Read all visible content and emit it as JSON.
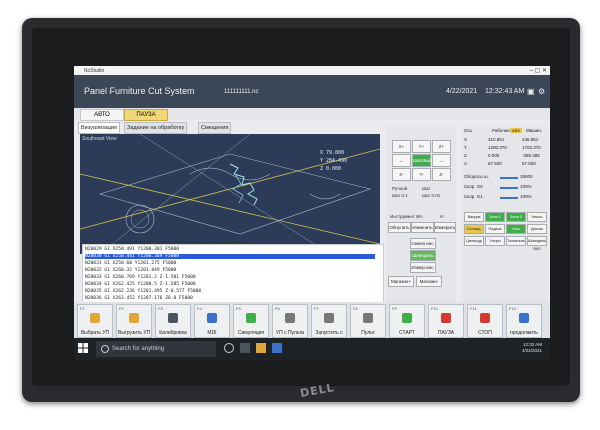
{
  "titlebar": {
    "app": "NcStudio"
  },
  "header": {
    "title": "Panel Furniture Cut System",
    "file": "111111111.nc",
    "date": "4/22/2021",
    "time": "12:32:43 AM"
  },
  "modes": [
    {
      "label": "АВТО"
    },
    {
      "label": "ПАУЗА"
    }
  ],
  "tabs": [
    {
      "label": "Визуализация"
    },
    {
      "label": "Задание на обработку"
    },
    {
      "label": "Смещения"
    }
  ],
  "viewport": {
    "view_label": "Southeast View",
    "coords": [
      "X  79.800",
      "Y  284.490",
      "Z  0.000"
    ]
  },
  "status_message": "Memory: 10MCSSM    The track occupies too much memory and it has been automatically cut.",
  "nc_lines": [
    {
      "text": "N20029  G1 X250.491 Y1200.381 F5000",
      "selected": false
    },
    {
      "text": "N20030  G1 X250.441 Y1200.369 F5000",
      "selected": true
    },
    {
      "text": "N20031  G1 X250.68 Y1201.275 F5000",
      "selected": false
    },
    {
      "text": "N20032  G1 X260.32 Y1201.849 F5000",
      "selected": false
    },
    {
      "text": "N20033  G1 X260.769 Y1201.2 Z-1.581 F5000",
      "selected": false
    },
    {
      "text": "N20034  G1 X262.425 Y1200.5 Z-1.585 F5000",
      "selected": false
    },
    {
      "text": "N20035  G1 X262.236 Y1201.495 Z-0.577 F5000",
      "selected": false
    },
    {
      "text": "N20036  G1 X263.452 Y1207.176 Z0.0 F5000",
      "selected": false
    },
    {
      "text": "N20037  G1 X263.453 Y1206.01 Z-0.511 F5000",
      "selected": false
    }
  ],
  "jog": {
    "keys": [
      "X+",
      "Y+",
      "Z+",
      "X-",
      "Y-",
      "Z-"
    ],
    "center": "Шаговый",
    "options": [
      "Ручной",
      "Шаг",
      "Шаг 0.1",
      "Шаг 0.01"
    ]
  },
  "tool": {
    "label": "Инструмент ИН",
    "n_label": "Н:",
    "buttons": [
      "Обнулить",
      "Изменить",
      "Измерить"
    ],
    "spindle": [
      "Смена инс.",
      "Шпиндель",
      "Измер.инс.",
      "Магазин+",
      "Магазин-"
    ]
  },
  "coords_panel": {
    "headers": [
      "Ось",
      "Рабочие",
      "Машин."
    ],
    "rows": [
      {
        "axis": "X",
        "work": "310.861",
        "mach": "446.861"
      },
      {
        "axis": "Y",
        "work": "1200.370",
        "mach": "1702.370"
      },
      {
        "axis": "Z",
        "work": "0.000",
        "mach": "-385.385"
      },
      {
        "axis": "A",
        "work": "67.500",
        "mach": "67.500"
      }
    ],
    "badge": "ABS",
    "feed_labels": [
      "Обороты ш.",
      "Скор. G0",
      "Скор. G1"
    ],
    "feed_values": [
      "18000",
      "100%",
      "100%"
    ],
    "buttons": [
      "Вакуум",
      "Зона 1",
      "Зона 2",
      "Насос",
      "Охлажд.",
      "Подача",
      "Нож",
      "Датчик",
      "Цилиндр",
      "Упоры",
      "Толкатель",
      "Шпиндель ВКЛ"
    ]
  },
  "fkeys": [
    {
      "n": "F1",
      "label": "Выбрать УП",
      "icon": "folder-icon",
      "color": "#e1a63b"
    },
    {
      "n": "F2",
      "label": "Выгрузить УП",
      "icon": "folder-icon",
      "color": "#e1a63b"
    },
    {
      "n": "F3",
      "label": "Калибровка",
      "icon": "calibrate-icon",
      "color": "#4b5560"
    },
    {
      "n": "F4",
      "label": "MDI",
      "icon": "mdi-icon",
      "color": "#3a71c9"
    },
    {
      "n": "F5",
      "label": "Симуляция",
      "icon": "simulation-icon",
      "color": "#3fae4a"
    },
    {
      "n": "F6",
      "label": "УП с Пульта",
      "icon": "remote-icon",
      "color": "#777"
    },
    {
      "n": "F7",
      "label": "Запустить с",
      "icon": "run-from-icon",
      "color": "#777"
    },
    {
      "n": "F8",
      "label": "Пульт",
      "icon": "remote-control-icon",
      "color": "#777"
    },
    {
      "n": "F9",
      "label": "СТАРТ",
      "icon": "start-icon",
      "color": "#3fae4a"
    },
    {
      "n": "F10",
      "label": "ПАУЗА",
      "icon": "pause-icon",
      "color": "#d33a32"
    },
    {
      "n": "F11",
      "label": "СТОП",
      "icon": "stop-icon",
      "color": "#d33a32"
    },
    {
      "n": "F12",
      "label": "продолжить",
      "icon": "continue-icon",
      "color": "#3a71c9"
    }
  ],
  "taskbar": {
    "search_placeholder": "Search for anything",
    "clock_time": "12:32 AM",
    "clock_date": "4/22/2021"
  },
  "colors": {
    "header_bg": "#3b4656",
    "auto_bg": "#f5f5f5",
    "pause_bg": "#f1d77a",
    "nc_select": "#2a5bd7"
  }
}
